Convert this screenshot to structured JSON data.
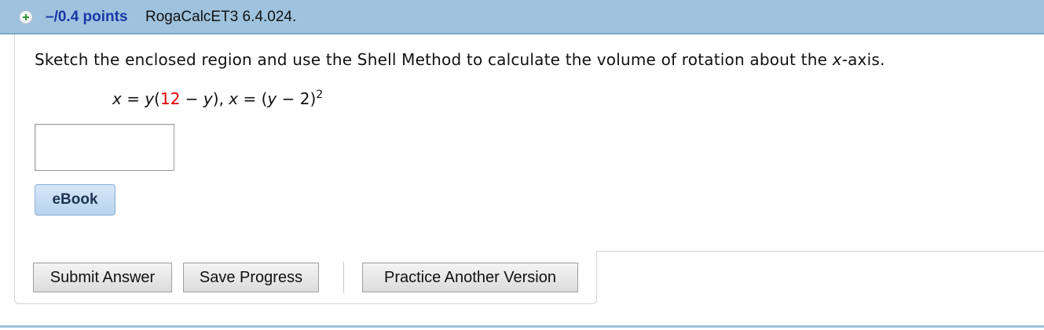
{
  "header": {
    "points": "–/0.4 points",
    "question_id": "RogaCalcET3 6.4.024."
  },
  "question": {
    "prompt_before": "Sketch the enclosed region and use the Shell Method to calculate the volume of rotation about the ",
    "prompt_var": "x",
    "prompt_after": "-axis.",
    "eq_x1": "x",
    "eq_part1": " = ",
    "eq_y1": "y",
    "eq_paren_open": "(",
    "eq_red_num": "12",
    "eq_minus1": " − ",
    "eq_y2": "y",
    "eq_close_comma": "), ",
    "eq_x2": "x",
    "eq_part2": " = (",
    "eq_y3": "y",
    "eq_minus2": " − 2)",
    "eq_exp": "2",
    "answer_value": ""
  },
  "buttons": {
    "ebook": "eBook",
    "submit": "Submit Answer",
    "save": "Save Progress",
    "practice": "Practice Another Version"
  },
  "colors": {
    "header_bg": "#9fc3de",
    "points_text": "#1a37a8",
    "highlight_red": "#e00000"
  }
}
